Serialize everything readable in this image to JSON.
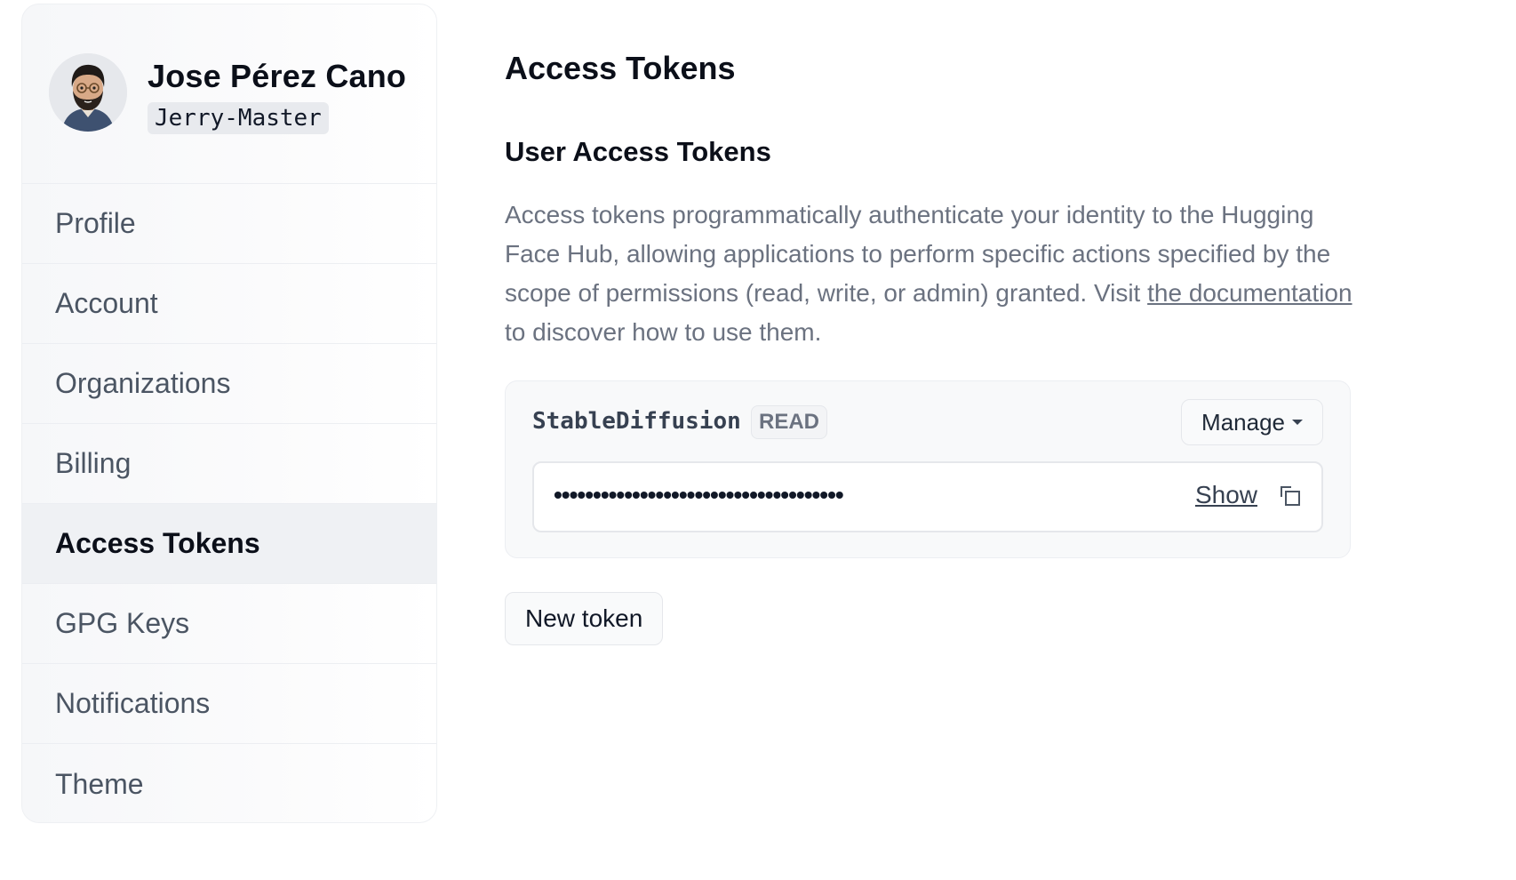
{
  "user": {
    "display_name": "Jose Pérez Cano",
    "username": "Jerry-Master"
  },
  "sidebar": {
    "items": [
      {
        "label": "Profile"
      },
      {
        "label": "Account"
      },
      {
        "label": "Organizations"
      },
      {
        "label": "Billing"
      },
      {
        "label": "Access Tokens",
        "active": true
      },
      {
        "label": "GPG Keys"
      },
      {
        "label": "Notifications"
      },
      {
        "label": "Theme"
      }
    ]
  },
  "main": {
    "title": "Access Tokens",
    "section_title": "User Access Tokens",
    "description_before": "Access tokens programmatically authenticate your identity to the Hugging Face Hub, allowing applications to perform specific actions specified by the scope of permissions (read, write, or admin) granted. Visit ",
    "description_link": "the documentation",
    "description_after": " to discover how to use them."
  },
  "token": {
    "name": "StableDiffusion",
    "role": "READ",
    "manage_label": "Manage",
    "masked_value": "•••••••••••••••••••••••••••••••••••••",
    "show_label": "Show"
  },
  "actions": {
    "new_token_label": "New token"
  },
  "icons": {
    "avatar": "avatar-icon",
    "caret": "chevron-down-icon",
    "copy": "copy-icon"
  }
}
